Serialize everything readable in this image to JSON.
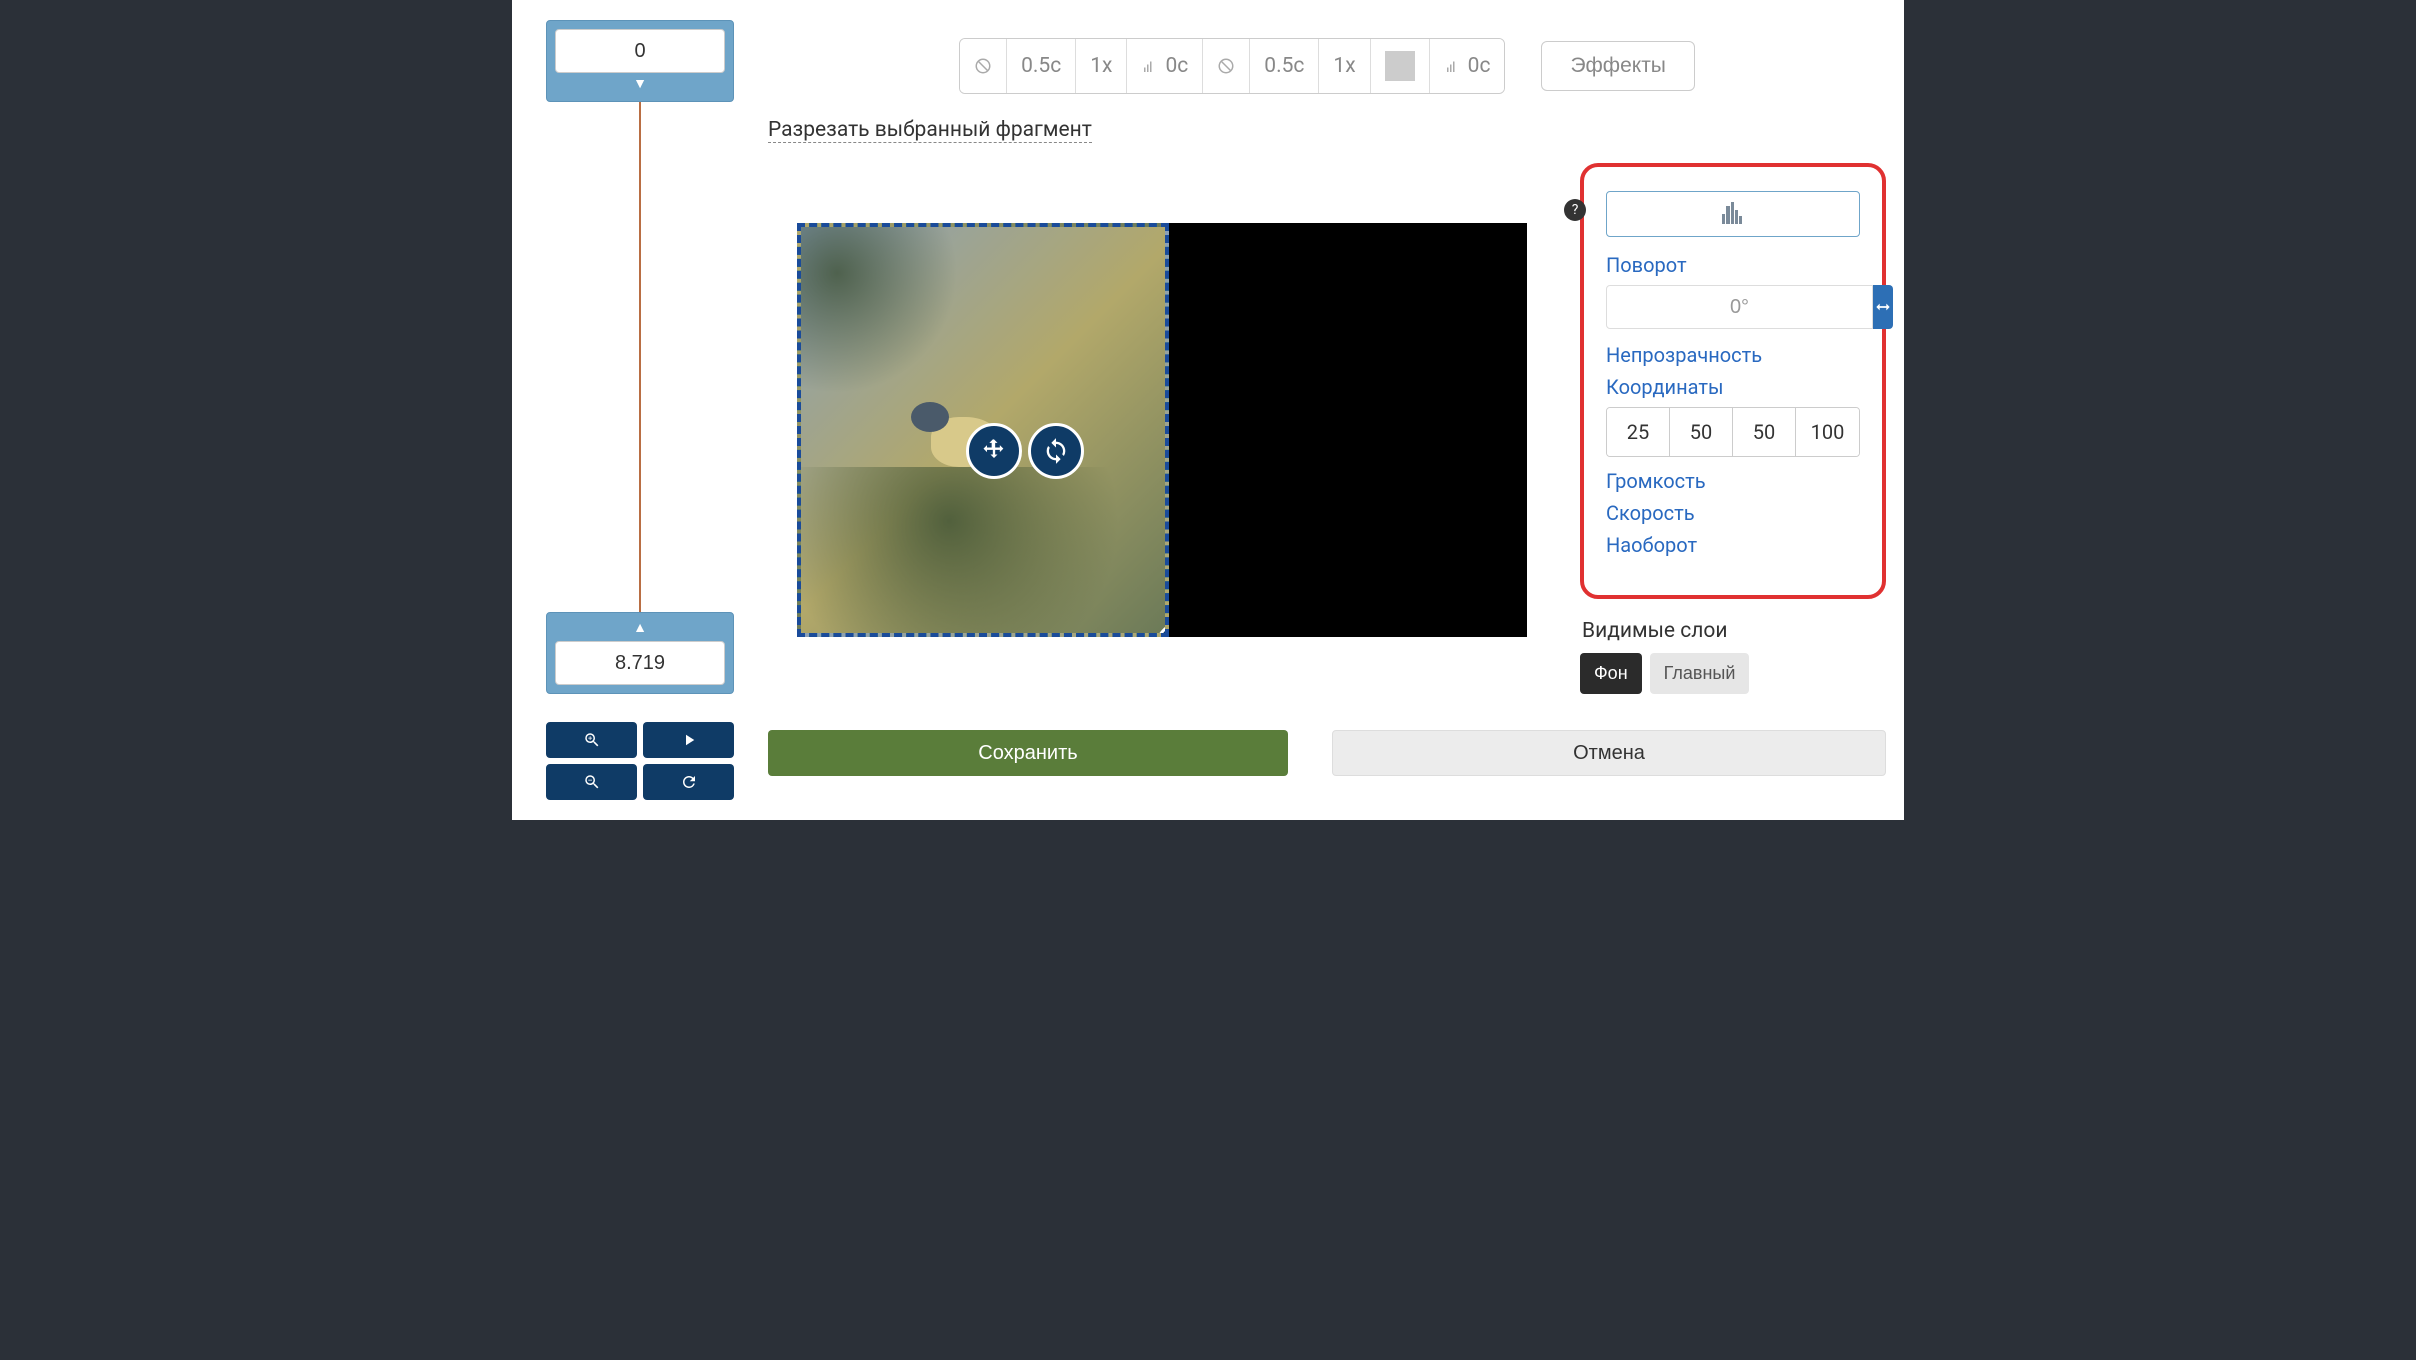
{
  "timeline": {
    "start_value": "0",
    "end_value": "8.719"
  },
  "toolbar": {
    "group_a": {
      "duration": "0.5c",
      "speed": "1x",
      "fade": "0c"
    },
    "group_b": {
      "duration": "0.5c",
      "speed": "1x",
      "fade": "0c"
    },
    "effects_label": "Эффекты"
  },
  "cut_link": "Разрезать выбранный фрагмент",
  "panel": {
    "rotation_label": "Поворот",
    "rotation_value": "0°",
    "opacity_label": "Непрозрачность",
    "coords_label": "Координаты",
    "coords": [
      "25",
      "50",
      "50",
      "100"
    ],
    "volume_label": "Громкость",
    "speed_label": "Скорость",
    "reverse_label": "Наоборот"
  },
  "layers": {
    "title": "Видимые слои",
    "background": "Фон",
    "main": "Главный"
  },
  "buttons": {
    "save": "Сохранить",
    "cancel": "Отмена"
  },
  "icons": {
    "help": "?"
  }
}
